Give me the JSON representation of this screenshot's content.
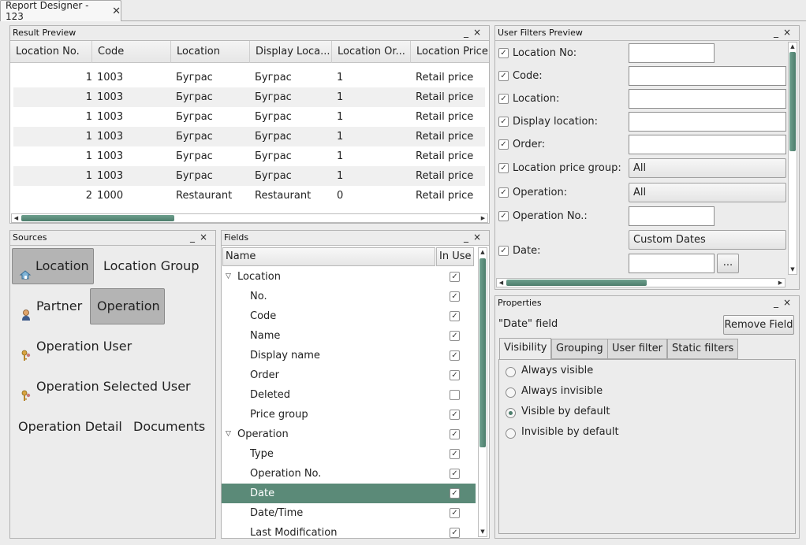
{
  "document_tab": {
    "title": "Report Designer - 123",
    "close": "✕"
  },
  "panel_controls": {
    "minimize": "_",
    "close": "×"
  },
  "result_preview": {
    "title": "Result Preview",
    "columns": [
      "Location No.",
      "Code",
      "Location",
      "Display Loca...",
      "Location Or...",
      "Location Price"
    ],
    "rows": [
      [
        "1",
        "1003",
        "Буграс",
        "Буграс",
        "1",
        "Retail price"
      ],
      [
        "1",
        "1003",
        "Буграс",
        "Буграс",
        "1",
        "Retail price"
      ],
      [
        "1",
        "1003",
        "Буграс",
        "Буграс",
        "1",
        "Retail price"
      ],
      [
        "1",
        "1003",
        "Буграс",
        "Буграс",
        "1",
        "Retail price"
      ],
      [
        "1",
        "1003",
        "Буграс",
        "Буграс",
        "1",
        "Retail price"
      ],
      [
        "1",
        "1003",
        "Буграс",
        "Буграс",
        "1",
        "Retail price"
      ],
      [
        "2",
        "1000",
        "Restaurant",
        "Restaurant",
        "0",
        "Retail price"
      ]
    ]
  },
  "sources": {
    "title": "Sources",
    "items": [
      {
        "label": "Location",
        "icon": "location-icon",
        "selected": true
      },
      {
        "label": "Location Group",
        "icon": "",
        "selected": false
      },
      {
        "label": "Partner",
        "icon": "partner-icon",
        "selected": false
      },
      {
        "label": "Operation",
        "icon": "",
        "selected": true
      },
      {
        "label": "Operation User",
        "icon": "user-key-icon",
        "selected": false
      },
      {
        "label": "Operation Selected User",
        "icon": "user-key-icon",
        "selected": false
      },
      {
        "label": "Operation Detail",
        "icon": "",
        "selected": false
      },
      {
        "label": "Documents",
        "icon": "",
        "selected": false
      }
    ]
  },
  "fields": {
    "title": "Fields",
    "col_name": "Name",
    "col_in_use": "In Use",
    "rows": [
      {
        "label": "Location",
        "group": true,
        "checked": true
      },
      {
        "label": "No.",
        "group": false,
        "checked": true
      },
      {
        "label": "Code",
        "group": false,
        "checked": true
      },
      {
        "label": "Name",
        "group": false,
        "checked": true
      },
      {
        "label": "Display name",
        "group": false,
        "checked": true
      },
      {
        "label": "Order",
        "group": false,
        "checked": true
      },
      {
        "label": "Deleted",
        "group": false,
        "checked": false
      },
      {
        "label": "Price group",
        "group": false,
        "checked": true
      },
      {
        "label": "Operation",
        "group": true,
        "checked": true
      },
      {
        "label": "Type",
        "group": false,
        "checked": true
      },
      {
        "label": "Operation No.",
        "group": false,
        "checked": true
      },
      {
        "label": "Date",
        "group": false,
        "checked": true,
        "selected": true
      },
      {
        "label": "Date/Time",
        "group": false,
        "checked": true
      },
      {
        "label": "Last Modification",
        "group": false,
        "checked": true
      }
    ]
  },
  "user_filters": {
    "title": "User Filters Preview",
    "location_no": "Location No:",
    "code": "Code:",
    "location": "Location:",
    "display_location": "Display location:",
    "order": "Order:",
    "location_price_group": "Location price group:",
    "location_price_group_value": "All",
    "operation": "Operation:",
    "operation_value": "All",
    "operation_no": "Operation No.:",
    "date": "Date:",
    "date_value": "Custom Dates",
    "ellipsis": "..."
  },
  "properties": {
    "title": "Properties",
    "field_label": "\"Date\" field",
    "remove_button": "Remove Field",
    "tabs": [
      "Visibility",
      "Grouping",
      "User filter",
      "Static filters"
    ],
    "options": [
      {
        "label": "Always visible",
        "selected": false
      },
      {
        "label": "Always invisible",
        "selected": false
      },
      {
        "label": "Visible by default",
        "selected": true
      },
      {
        "label": "Invisible by default",
        "selected": false
      }
    ]
  },
  "colors": {
    "accent": "#5b8a78",
    "scroll_thumb": "#4d7d6c"
  }
}
